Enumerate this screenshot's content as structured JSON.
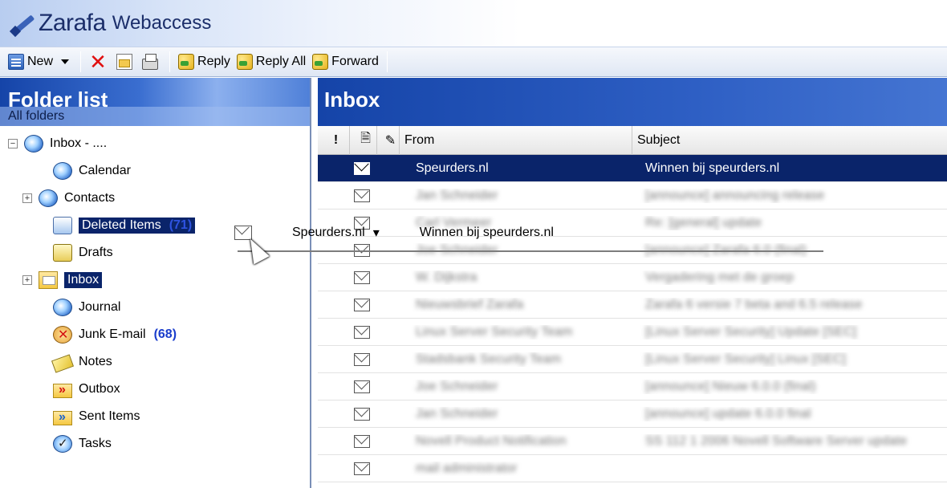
{
  "app": {
    "brand": "Zarafa",
    "product": "Webaccess"
  },
  "toolbar": {
    "new_label": "New",
    "reply_label": "Reply",
    "reply_all_label": "Reply All",
    "forward_label": "Forward"
  },
  "folders": {
    "title": "Folder list",
    "subtitle": "All folders",
    "root_label": "Inbox - ....",
    "items": [
      {
        "label": "Calendar",
        "icon": "calendar-icon"
      },
      {
        "label": "Contacts",
        "icon": "contacts-icon"
      },
      {
        "label": "Deleted Items",
        "icon": "deleted-items-icon",
        "count": "(71)"
      },
      {
        "label": "Drafts",
        "icon": "drafts-icon"
      },
      {
        "label": "Inbox",
        "icon": "inbox-folder-icon"
      },
      {
        "label": "Journal",
        "icon": "journal-icon"
      },
      {
        "label": "Junk E-mail",
        "icon": "junk-icon",
        "count": "(68)"
      },
      {
        "label": "Notes",
        "icon": "notes-icon"
      },
      {
        "label": "Outbox",
        "icon": "outbox-icon"
      },
      {
        "label": "Sent Items",
        "icon": "sent-items-icon"
      },
      {
        "label": "Tasks",
        "icon": "tasks-icon"
      }
    ]
  },
  "inbox": {
    "title": "Inbox",
    "columns": {
      "importance": "!",
      "from": "From",
      "subject": "Subject"
    },
    "messages": [
      {
        "from": "Speurders.nl",
        "subject": "Winnen bij speurders.nl"
      },
      {
        "from": "Jan Schneider",
        "subject": "[announce] announcing release"
      },
      {
        "from": "Carl Vermeer",
        "subject": "Re: [general] update"
      },
      {
        "from": "Joe Schneider",
        "subject": "[announce] Zarafa 6.0 (final)"
      },
      {
        "from": "W. Dijkstra",
        "subject": "Vergadering met de groep"
      },
      {
        "from": "Nieuwsbrief Zarafa",
        "subject": "Zarafa 6 versie 7 beta and 6.5 release"
      },
      {
        "from": "Linux Server Security Team",
        "subject": "[Linux Server Security] Update [SEC]"
      },
      {
        "from": "Stadsbank Security Team",
        "subject": "[Linux Server Security] Linux [SEC]"
      },
      {
        "from": "Joe Schneider",
        "subject": "[announce] Nieuw 6.0.0 (final)"
      },
      {
        "from": "Jan Schneider",
        "subject": "[announce] update 6.0.0 final"
      },
      {
        "from": "Novell Product Notification",
        "subject": "SS 112 1 2006 Novell Software Server update"
      },
      {
        "from": "mail administrator",
        "subject": ""
      }
    ]
  },
  "drag": {
    "from": "Speurders.nl",
    "subject": "Winnen bij speurders.nl"
  }
}
